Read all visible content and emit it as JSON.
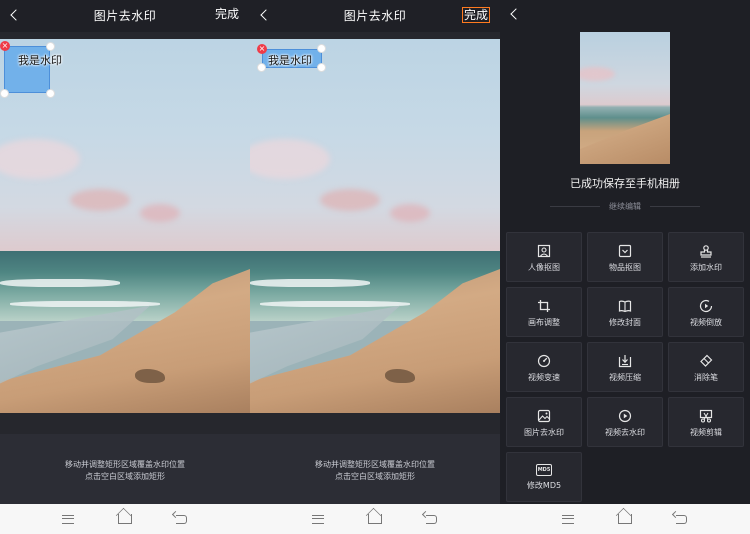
{
  "screens": [
    {
      "title": "图片去水印",
      "done_label": "完成",
      "watermark_text": "我是水印",
      "hint_lines": [
        "移动并调整矩形区域覆盖水印位置",
        "点击空白区域添加矩形"
      ]
    },
    {
      "title": "图片去水印",
      "done_label": "完成",
      "watermark_text": "我是水印",
      "hint_lines": [
        "移动并调整矩形区域覆盖水印位置",
        "点击空白区域添加矩形"
      ]
    },
    {
      "saved_text": "已成功保存至手机相册",
      "continue_label": "继续编辑",
      "tools": [
        {
          "label": "人像抠图",
          "icon": "portrait-icon"
        },
        {
          "label": "物品抠图",
          "icon": "object-cutout-icon"
        },
        {
          "label": "添加水印",
          "icon": "stamp-icon"
        },
        {
          "label": "画布调整",
          "icon": "crop-icon"
        },
        {
          "label": "修改封面",
          "icon": "book-icon"
        },
        {
          "label": "视频倒放",
          "icon": "reverse-play-icon"
        },
        {
          "label": "视频变速",
          "icon": "speed-icon"
        },
        {
          "label": "视频压缩",
          "icon": "compress-icon"
        },
        {
          "label": "消除笔",
          "icon": "eraser-icon"
        },
        {
          "label": "图片去水印",
          "icon": "image-icon"
        },
        {
          "label": "视频去水印",
          "icon": "play-circle-icon"
        },
        {
          "label": "视频剪辑",
          "icon": "scissors-icon"
        },
        {
          "label": "修改MD5",
          "icon": "md5-icon"
        }
      ],
      "md5_icon_text": "MD5"
    }
  ],
  "colors": {
    "background": "#26272d",
    "done_highlight": "#ff7a1f",
    "selection_fill": "#64aaeb",
    "delete_badge": "#ef3b48"
  }
}
